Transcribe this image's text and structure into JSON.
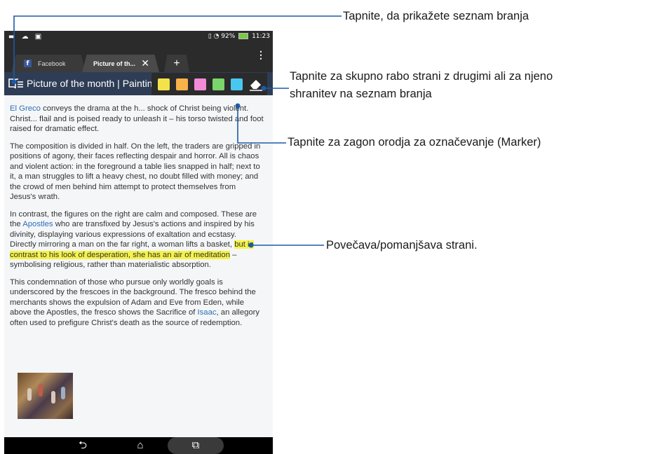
{
  "status_bar": {
    "left_icons": "▬ ☁ ▣",
    "battery": "92%",
    "time": "11:23"
  },
  "tabs": [
    {
      "label": "Facebook",
      "icon": "facebook-icon",
      "active": false
    },
    {
      "label": "Picture of th...",
      "icon": "close-icon",
      "active": true
    }
  ],
  "new_tab_label": "+",
  "address_bar": {
    "title": "Picture of the month | Paintings | The...",
    "bg_color": "#2e3d55"
  },
  "marker_palette": {
    "colors": [
      "#f4e24a",
      "#f7b24a",
      "#f28ad8",
      "#7ad66a",
      "#48c8f0"
    ],
    "eraser": "eraser-icon"
  },
  "article": {
    "p1": {
      "link": "El Greco",
      "text": " conveys the drama at the h... shock of Christ being violent. Christ... flail and is poised ready to unleash it – his torso twisted and foot raised for dramatic effect."
    },
    "p2": "The composition is divided in half. On the left, the traders are gripped in positions of agony, their faces reflecting despair and horror. All is chaos and violent action: in the foreground a table lies snapped in half; next to it, a man struggles to lift a heavy chest, no doubt filled with money; and the crowd of men behind him attempt to protect themselves from Jesus's wrath.",
    "p3": {
      "a": "In contrast, the figures on the right are calm and composed. These are the ",
      "link": "Apostles",
      "b": " who are transfixed by Jesus's actions and inspired by his divinity, displaying various expressions of exaltation and ecstasy. Directly mirroring a man on the far right, a woman lifts a basket, ",
      "highlight": "but in contrast to his look of desperation, she has an air of meditation",
      "c": " – symbolising religious, rather than materialistic absorption."
    },
    "p4": {
      "a": "This condemnation of those who pursue only worldly goals is underscored by the frescoes in the background. The fresco behind the merchants shows the expulsion of Adam and Eve from Eden, while above the Apostles, the fresco shows the Sacrifice of ",
      "link": "Isaac",
      "b": ", an allegory often used to prefigure Christ's death as the source of redemption."
    }
  },
  "nav": {
    "back": "⮌",
    "home": "⌂",
    "recent": "⧉"
  },
  "callouts": {
    "reading_list": "Tapnite, da prikažete seznam branja",
    "share_line1": "Tapnite za skupno rabo strani z drugimi ali za njeno",
    "share_line2": "shranitev na seznam branja",
    "marker": "Tapnite za zagon orodja za označevanje (Marker)",
    "zoom": "Povečava/pomanjšava strani."
  },
  "colors": {
    "callout_line": "#1c5aa8",
    "link": "#2f6fb5",
    "highlight": "#f5f34a"
  }
}
